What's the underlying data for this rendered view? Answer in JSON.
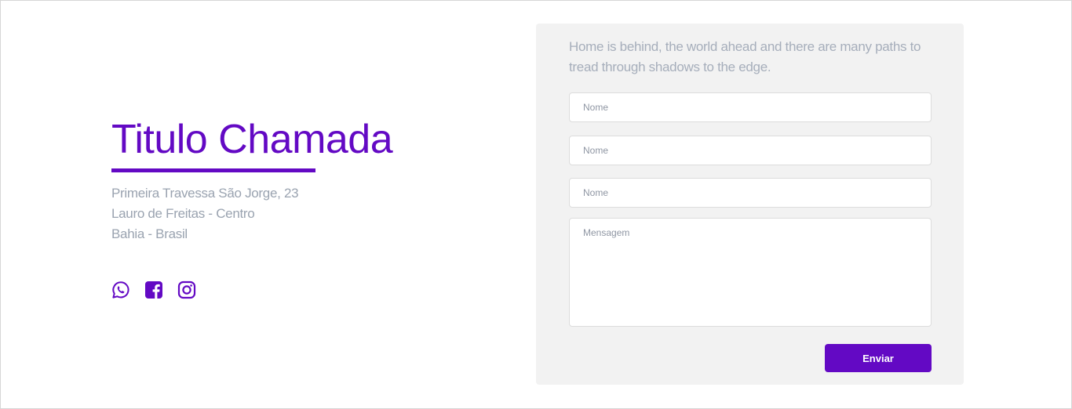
{
  "contact": {
    "title": "Titulo Chamada",
    "address": [
      "Primeira Travessa São Jorge, 23",
      "Lauro de Freitas - Centro",
      "Bahia - Brasil"
    ],
    "social_icons": [
      "whatsapp-icon",
      "facebook-icon",
      "instagram-icon"
    ]
  },
  "form": {
    "intro": "Home is behind, the world ahead and there are many paths to tread through shadows to the edge.",
    "field_1_placeholder": "Nome",
    "field_2_placeholder": "Nome",
    "field_3_placeholder": "Nome",
    "message_placeholder": "Mensagem",
    "submit_label": "Enviar"
  },
  "colors": {
    "accent": "#6309c4",
    "muted_text": "#9aa3b0",
    "card_bg": "#f2f2f2"
  }
}
